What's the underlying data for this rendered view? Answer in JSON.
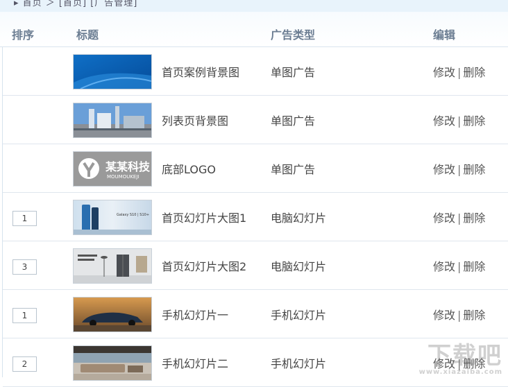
{
  "breadcrumb": "▸ 首页 ＞ [首页] [广告管理]",
  "columns": {
    "sort": "排序",
    "title": "标题",
    "type": "广告类型",
    "edit": "编辑"
  },
  "rows": [
    {
      "sort": "",
      "title": "首页案例背景图",
      "type": "单图广告",
      "edit_label": "修改",
      "delete_label": "删除",
      "thumb": "blue-wave"
    },
    {
      "sort": "",
      "title": "列表页背景图",
      "type": "单图广告",
      "edit_label": "修改",
      "delete_label": "删除",
      "thumb": "building"
    },
    {
      "sort": "",
      "title": "底部LOGO",
      "type": "单图广告",
      "edit_label": "修改",
      "delete_label": "删除",
      "thumb": "logo",
      "logo_text": "某某科技",
      "logo_sub": "MOUMOUKEJI"
    },
    {
      "sort": "1",
      "title": "首页幻灯片大图1",
      "type": "电脑幻灯片",
      "edit_label": "修改",
      "delete_label": "删除",
      "thumb": "phone",
      "thumb_text": "Galaxy S10 | S10+"
    },
    {
      "sort": "3",
      "title": "首页幻灯片大图2",
      "type": "电脑幻灯片",
      "edit_label": "修改",
      "delete_label": "删除",
      "thumb": "fridge"
    },
    {
      "sort": "1",
      "title": "手机幻灯片一",
      "type": "手机幻灯片",
      "edit_label": "修改",
      "delete_label": "删除",
      "thumb": "car"
    },
    {
      "sort": "2",
      "title": "手机幻灯片二",
      "type": "手机幻灯片",
      "edit_label": "修改",
      "delete_label": "删除",
      "thumb": "sofa"
    }
  ],
  "separator": "|",
  "watermark": {
    "main": "下载吧",
    "sub": "www.xiazaiba.com"
  },
  "colors": {
    "header_text": "#6b7d92",
    "row_border": "#dfe6ee",
    "top_strip": "#e8f3fb"
  }
}
